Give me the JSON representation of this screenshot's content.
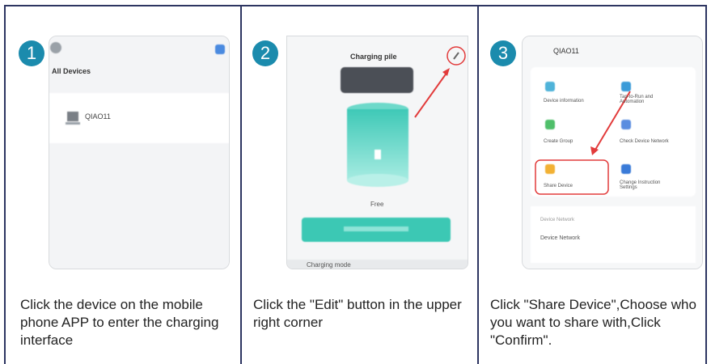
{
  "steps": [
    {
      "number": "1",
      "caption": "Click the device on the mobile phone APP to enter the charging interface",
      "phone": {
        "heading": "All Devices",
        "device_name": "QIAO11"
      }
    },
    {
      "number": "2",
      "caption": "Click the \"Edit\" button in the upper right corner",
      "phone": {
        "title": "Charging pile",
        "status": "Free",
        "bottom_label": "Charging mode"
      }
    },
    {
      "number": "3",
      "caption": "Click \"Share Device\",Choose who you want to share with,Click \"Confirm\".",
      "phone": {
        "title": "QIAO11",
        "tiles": [
          "Device information",
          "Tap-to-Run and Automation",
          "Create Group",
          "Check Device Network",
          "Share Device",
          "Change Instruction Settings"
        ],
        "section_label": "Device Network",
        "section_sub": "Device Network"
      }
    }
  ],
  "colors": {
    "accent": "#1b8bad",
    "highlight": "#e23b3b",
    "teal": "#3cc8b4",
    "border": "#2d3561"
  }
}
